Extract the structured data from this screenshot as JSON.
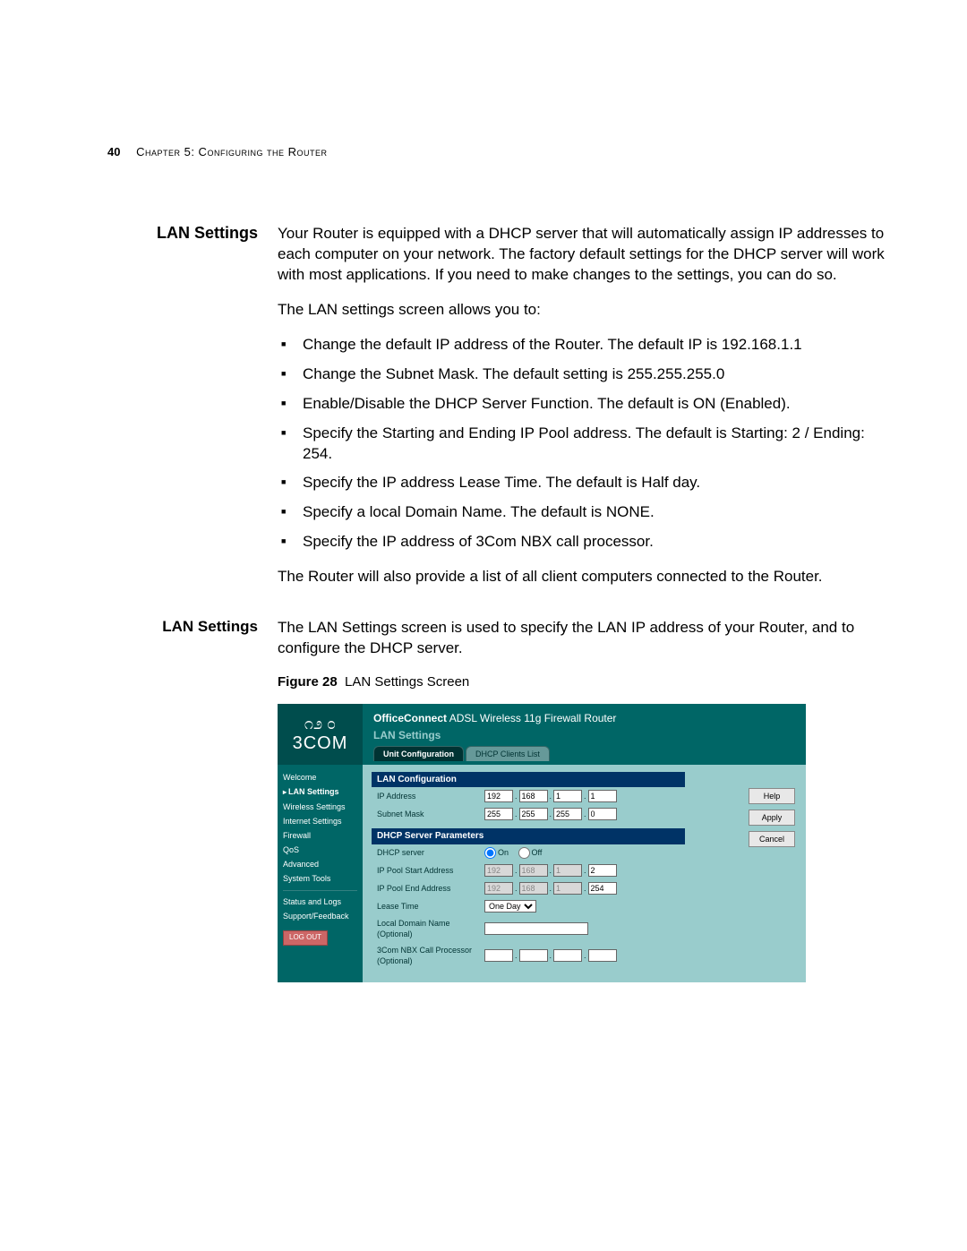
{
  "page": {
    "number": "40",
    "chapter_header": "Chapter 5: Configuring the Router"
  },
  "section1": {
    "heading": "LAN Settings",
    "p1": "Your Router is equipped with a DHCP server that will automatically assign IP addresses to each computer on your network. The factory default settings for the DHCP server will work with most applications. If you need to make changes to the settings, you can do so.",
    "p2": "The LAN settings screen allows you to:",
    "bullets": [
      "Change the default IP address of the Router. The default IP is 192.168.1.1",
      "Change the Subnet Mask. The default setting is 255.255.255.0",
      "Enable/Disable the DHCP Server Function. The default is ON (Enabled).",
      "Specify the Starting and Ending IP Pool address. The default is Starting: 2 / Ending: 254.",
      "Specify the IP address Lease Time. The default is Half day.",
      "Specify a local Domain Name. The default is NONE.",
      "Specify the IP address of 3Com NBX call processor."
    ],
    "p3": "The Router will also provide a list of all client computers connected to the Router."
  },
  "section2": {
    "heading": "LAN Settings",
    "p1": "The LAN Settings screen is used to specify the LAN IP address of your Router, and to configure the DHCP server.",
    "figure_label": "Figure 28",
    "figure_title": "LAN Settings Screen"
  },
  "screenshot": {
    "brand_glyph": "೧೨ ೦",
    "brand": "3COM",
    "product_bold": "OfficeConnect",
    "product_rest": "ADSL Wireless 11g Firewall Router",
    "page_name": "LAN Settings",
    "tabs": {
      "active": "Unit Configuration",
      "inactive": "DHCP Clients List"
    },
    "nav": {
      "items": [
        "Welcome",
        "LAN Settings",
        "Wireless Settings",
        "Internet Settings",
        "Firewall",
        "QoS",
        "Advanced",
        "System Tools"
      ],
      "active_index": 1,
      "lower": [
        "Status and Logs",
        "Support/Feedback"
      ],
      "logout": "LOG OUT"
    },
    "panels": {
      "lan_conf_title": "LAN Configuration",
      "ip_address_label": "IP Address",
      "ip_address": [
        "192",
        "168",
        "1",
        "1"
      ],
      "subnet_label": "Subnet Mask",
      "subnet": [
        "255",
        "255",
        "255",
        "0"
      ],
      "dhcp_title": "DHCP Server Parameters",
      "dhcp_server_label": "DHCP server",
      "dhcp_on": "On",
      "dhcp_off": "Off",
      "pool_start_label": "IP Pool Start Address",
      "pool_start": [
        "192",
        "168",
        "1",
        "2"
      ],
      "pool_end_label": "IP Pool End Address",
      "pool_end": [
        "192",
        "168",
        "1",
        "254"
      ],
      "lease_label": "Lease Time",
      "lease_value": "One Day",
      "domain_label": "Local Domain Name (Optional)",
      "nbx_label": "3Com NBX Call Processor (Optional)"
    },
    "buttons": {
      "help": "Help",
      "apply": "Apply",
      "cancel": "Cancel"
    }
  }
}
